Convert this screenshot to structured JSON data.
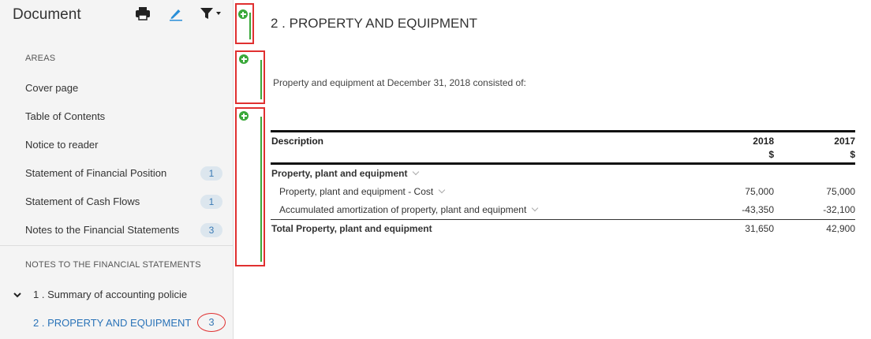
{
  "sidebar": {
    "title": "Document",
    "tools": {
      "print": "print-icon",
      "edit": "pencil-icon",
      "filter": "filter-icon"
    },
    "areas_label": "AREAS",
    "areas": [
      {
        "label": "Cover page",
        "badge": ""
      },
      {
        "label": "Table of Contents",
        "badge": ""
      },
      {
        "label": "Notice to reader",
        "badge": ""
      },
      {
        "label": "Statement of Financial Position",
        "badge": "1"
      },
      {
        "label": "Statement of Cash Flows",
        "badge": "1"
      },
      {
        "label": "Notes to the Financial Statements",
        "badge": "3"
      }
    ],
    "notes_label": "NOTES TO THE FINANCIAL STATEMENTS",
    "notes": [
      {
        "label": "1 . Summary of accounting policie",
        "badge": ""
      },
      {
        "label": "2 . PROPERTY AND EQUIPMENT",
        "badge": "3"
      }
    ]
  },
  "main": {
    "title": "2 . PROPERTY AND EQUIPMENT",
    "intro": "Property and equipment at December 31, 2018 consisted of:",
    "table": {
      "headers": {
        "description": "Description",
        "col1": "2018",
        "col1_unit": "$",
        "col2": "2017",
        "col2_unit": "$"
      },
      "group": "Property, plant and equipment",
      "rows": [
        {
          "label": "Property, plant and equipment - Cost",
          "v2018": "75,000",
          "v2017": "75,000"
        },
        {
          "label": "Accumulated amortization of property, plant and equipment",
          "v2018": "-43,350",
          "v2017": "-32,100"
        }
      ],
      "total": {
        "label": "Total Property, plant and equipment",
        "v2018": "31,650",
        "v2017": "42,900"
      }
    }
  },
  "colors": {
    "accent": "#2a73b8",
    "add": "#3aa83a",
    "highlight": "#e03030"
  }
}
